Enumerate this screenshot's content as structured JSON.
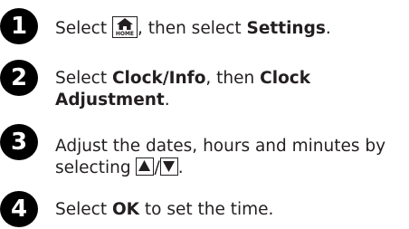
{
  "steps": [
    {
      "number": "1",
      "prefix": "Select ",
      "icon": "home-icon",
      "icon_label": "HOME",
      "middle": ", then select ",
      "bold": "Settings",
      "suffix": "."
    },
    {
      "number": "2",
      "prefix": "Select ",
      "bold1": "Clock/Info",
      "middle": ", then ",
      "bold2a": "Clock",
      "bold2b": "Adjustment",
      "suffix": "."
    },
    {
      "number": "3",
      "line1": "Adjust the dates, hours and minutes by",
      "line2_prefix": "selecting ",
      "up_icon": "up-arrow-icon",
      "separator": "/",
      "down_icon": "down-arrow-icon",
      "suffix": "."
    },
    {
      "number": "4",
      "prefix": "Select ",
      "bold": "OK",
      "suffix": " to set the time."
    }
  ]
}
